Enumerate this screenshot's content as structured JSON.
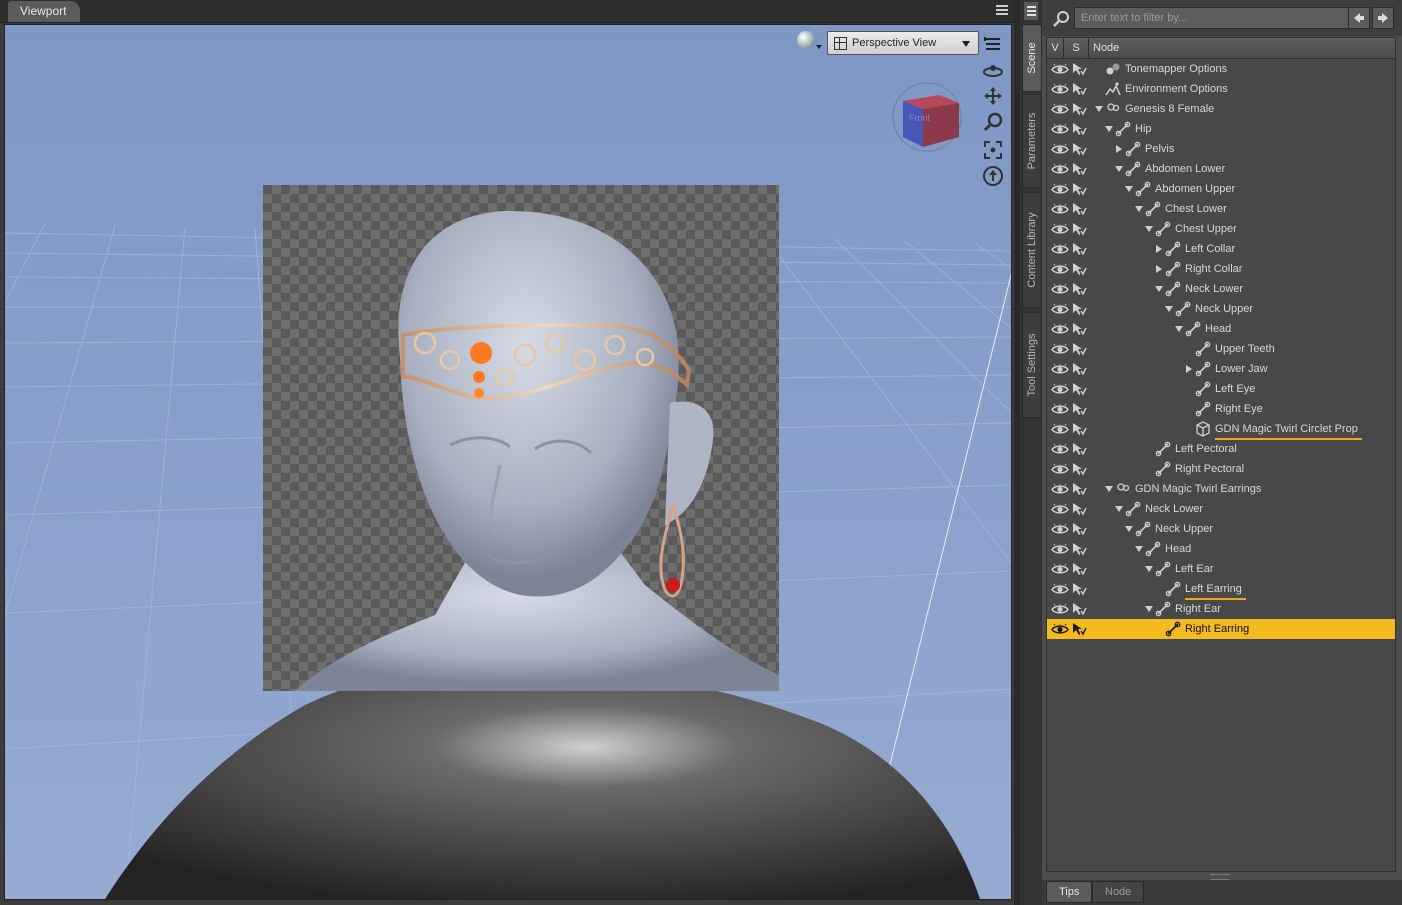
{
  "viewport": {
    "tab_label": "Viewport",
    "view_select": "Perspective View",
    "view_cube_label": "Front"
  },
  "side_tabs": [
    "Scene",
    "Parameters",
    "Content Library",
    "Tool Settings"
  ],
  "scene": {
    "filter_placeholder": "Enter text to filter by...",
    "columns": {
      "v": "V",
      "s": "S",
      "node": "Node"
    },
    "nodes": [
      {
        "label": "Tonemapper Options",
        "depth": 0,
        "toggle": "none",
        "icon": "tonemapper-icon"
      },
      {
        "label": "Environment Options",
        "depth": 0,
        "toggle": "none",
        "icon": "environment-icon"
      },
      {
        "label": "Genesis 8 Female",
        "depth": 0,
        "toggle": "expanded",
        "icon": "figure-icon"
      },
      {
        "label": "Hip",
        "depth": 1,
        "toggle": "expanded",
        "icon": "bone-icon"
      },
      {
        "label": "Pelvis",
        "depth": 2,
        "toggle": "collapsed",
        "icon": "bone-icon"
      },
      {
        "label": "Abdomen Lower",
        "depth": 2,
        "toggle": "expanded",
        "icon": "bone-icon"
      },
      {
        "label": "Abdomen Upper",
        "depth": 3,
        "toggle": "expanded",
        "icon": "bone-icon"
      },
      {
        "label": "Chest Lower",
        "depth": 4,
        "toggle": "expanded",
        "icon": "bone-icon"
      },
      {
        "label": "Chest Upper",
        "depth": 5,
        "toggle": "expanded",
        "icon": "bone-icon"
      },
      {
        "label": "Left Collar",
        "depth": 6,
        "toggle": "collapsed",
        "icon": "bone-icon"
      },
      {
        "label": "Right Collar",
        "depth": 6,
        "toggle": "collapsed",
        "icon": "bone-icon"
      },
      {
        "label": "Neck Lower",
        "depth": 6,
        "toggle": "expanded",
        "icon": "bone-icon"
      },
      {
        "label": "Neck Upper",
        "depth": 7,
        "toggle": "expanded",
        "icon": "bone-icon"
      },
      {
        "label": "Head",
        "depth": 8,
        "toggle": "expanded",
        "icon": "bone-icon"
      },
      {
        "label": "Upper Teeth",
        "depth": 9,
        "toggle": "none",
        "icon": "bone-icon"
      },
      {
        "label": "Lower Jaw",
        "depth": 9,
        "toggle": "collapsed",
        "icon": "bone-icon"
      },
      {
        "label": "Left Eye",
        "depth": 9,
        "toggle": "none",
        "icon": "bone-icon"
      },
      {
        "label": "Right Eye",
        "depth": 9,
        "toggle": "none",
        "icon": "bone-icon"
      },
      {
        "label": "GDN Magic Twirl Circlet Prop",
        "depth": 9,
        "toggle": "none",
        "icon": "prop-icon",
        "underline": true
      },
      {
        "label": "Left Pectoral",
        "depth": 5,
        "toggle": "none",
        "icon": "bone-icon"
      },
      {
        "label": "Right Pectoral",
        "depth": 5,
        "toggle": "none",
        "icon": "bone-icon"
      },
      {
        "label": "GDN Magic Twirl Earrings",
        "depth": 1,
        "toggle": "expanded",
        "icon": "figure-icon"
      },
      {
        "label": "Neck Lower",
        "depth": 2,
        "toggle": "expanded",
        "icon": "bone-icon"
      },
      {
        "label": "Neck Upper",
        "depth": 3,
        "toggle": "expanded",
        "icon": "bone-icon"
      },
      {
        "label": "Head",
        "depth": 4,
        "toggle": "expanded",
        "icon": "bone-icon"
      },
      {
        "label": "Left Ear",
        "depth": 5,
        "toggle": "expanded",
        "icon": "bone-icon"
      },
      {
        "label": "Left Earring",
        "depth": 6,
        "toggle": "none",
        "icon": "bone-icon",
        "underline": true
      },
      {
        "label": "Right Ear",
        "depth": 5,
        "toggle": "expanded",
        "icon": "bone-icon"
      },
      {
        "label": "Right Earring",
        "depth": 6,
        "toggle": "none",
        "icon": "bone-icon",
        "selected": true
      }
    ]
  },
  "bottom_tabs": [
    "Tips",
    "Node"
  ],
  "colors": {
    "selection": "#f4bb21",
    "underline": "#f4a51c"
  }
}
